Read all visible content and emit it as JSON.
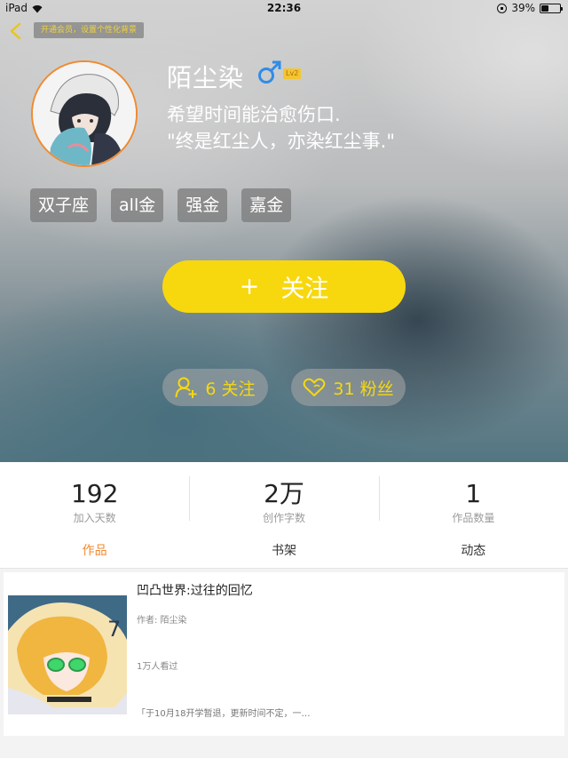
{
  "status_bar": {
    "device": "iPad",
    "time": "22:36",
    "battery": "39%",
    "battery_level": 0.39
  },
  "header": {
    "vip_banner": "开通会员，设置个性化背景"
  },
  "profile": {
    "name": "陌尘染",
    "level": "Lv2",
    "bio_line1": "希望时间能治愈伤口.",
    "bio_line2": "\"终是红尘人，亦染红尘事.\"",
    "tags": [
      "双子座",
      "all金",
      "强金",
      "嘉金"
    ]
  },
  "actions": {
    "follow_plus": "+",
    "follow_label": "关注",
    "following_label": "6 关注",
    "fans_label": "31 粉丝"
  },
  "stats": [
    {
      "value": "192",
      "label": "加入天数"
    },
    {
      "value": "2万",
      "label": "创作字数"
    },
    {
      "value": "1",
      "label": "作品数量"
    }
  ],
  "tabs": [
    "作品",
    "书架",
    "动态"
  ],
  "work": {
    "title": "凹凸世界:过往的回忆",
    "author": "作者: 陌尘染",
    "views": "1万人看过",
    "description": "「于10月18开学暂退，更新时间不定，一…"
  },
  "colors": {
    "accent": "#f08a2f",
    "follow_yellow": "#f7d80f",
    "gender_blue": "#2f8ce8"
  }
}
